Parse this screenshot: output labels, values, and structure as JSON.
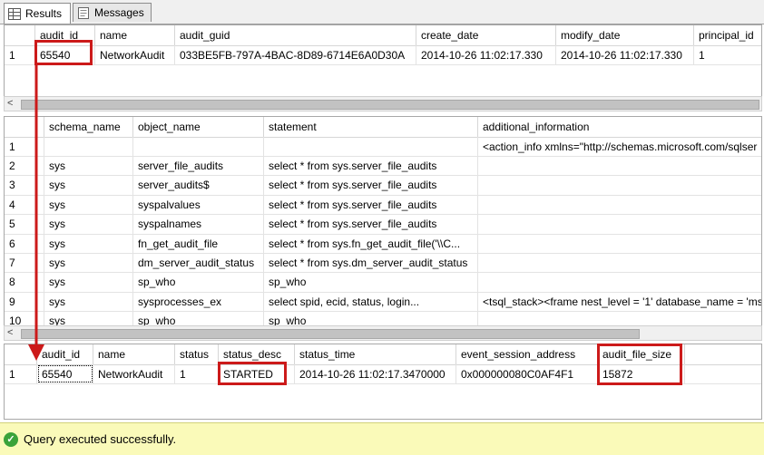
{
  "tabs": [
    {
      "label": "Results",
      "icon": "grid-results-icon",
      "active": true
    },
    {
      "label": "Messages",
      "icon": "messages-icon",
      "active": false
    }
  ],
  "grid1": {
    "columns": [
      "audit_id",
      "name",
      "audit_guid",
      "create_date",
      "modify_date",
      "principal_id"
    ],
    "rows": [
      {
        "num": "1",
        "cells": [
          "65540",
          "NetworkAudit",
          "033BE5FB-797A-4BAC-8D89-6714E6A0D30A",
          "2014-10-26 11:02:17.330",
          "2014-10-26 11:02:17.330",
          "1"
        ]
      }
    ]
  },
  "grid2": {
    "columns": [
      "schema_name",
      "object_name",
      "statement",
      "additional_information"
    ],
    "rows": [
      {
        "num": "1",
        "cells": [
          "",
          "",
          "",
          "<action_info xmlns=\"http://schemas.microsoft.com/sqlser"
        ]
      },
      {
        "num": "2",
        "cells": [
          "sys",
          "server_file_audits",
          "select * from sys.server_file_audits",
          ""
        ]
      },
      {
        "num": "3",
        "cells": [
          "sys",
          "server_audits$",
          "select * from sys.server_file_audits",
          ""
        ]
      },
      {
        "num": "4",
        "cells": [
          "sys",
          "syspalvalues",
          "select * from sys.server_file_audits",
          ""
        ]
      },
      {
        "num": "5",
        "cells": [
          "sys",
          "syspalnames",
          "select * from sys.server_file_audits",
          ""
        ]
      },
      {
        "num": "6",
        "cells": [
          "sys",
          "fn_get_audit_file",
          "select * from sys.fn_get_audit_file('\\\\C...",
          ""
        ]
      },
      {
        "num": "7",
        "cells": [
          "sys",
          "dm_server_audit_status",
          "select * from sys.dm_server_audit_status",
          ""
        ]
      },
      {
        "num": "8",
        "cells": [
          "sys",
          "sp_who",
          "sp_who",
          ""
        ]
      },
      {
        "num": "9",
        "cells": [
          "sys",
          "sysprocesses_ex",
          "select spid,     ecid,     status,     login...",
          "<tsql_stack><frame nest_level = '1' database_name = 'mss"
        ]
      },
      {
        "num": "10",
        "cells": [
          "sys",
          "sp_who",
          "sp_who",
          ""
        ]
      }
    ]
  },
  "grid3": {
    "columns": [
      "audit_id",
      "name",
      "status",
      "status_desc",
      "status_time",
      "event_session_address",
      "audit_file_size"
    ],
    "rows": [
      {
        "num": "1",
        "cells": [
          "65540",
          "NetworkAudit",
          "1",
          "STARTED",
          "2014-10-26 11:02:17.3470000",
          "0x000000080C0AF4F1",
          "15872"
        ]
      }
    ]
  },
  "status_bar": {
    "message": "Query executed successfully.",
    "icon": "check-circle-icon"
  },
  "colors": {
    "highlight": "#cc1a1a",
    "status_bg": "#fafab9"
  }
}
